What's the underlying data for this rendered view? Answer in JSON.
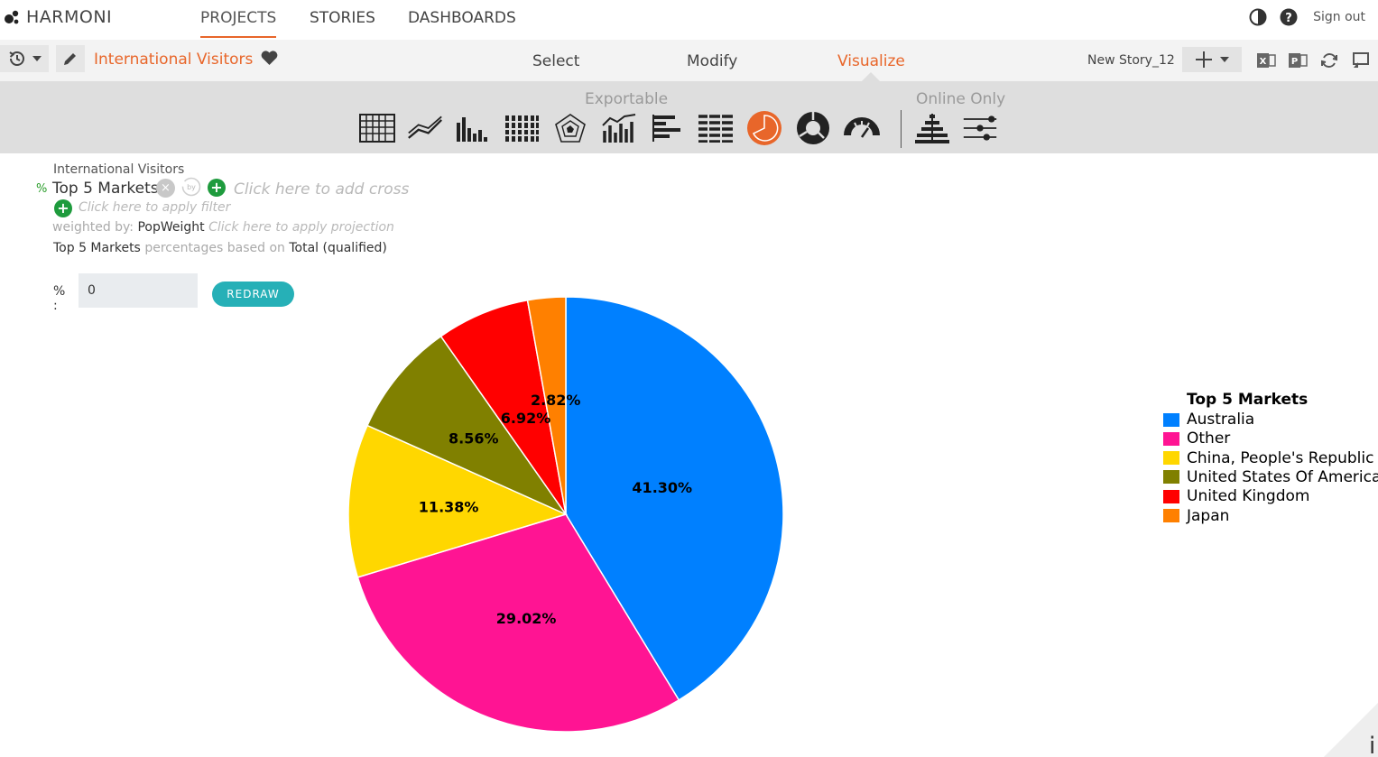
{
  "app": {
    "logo_text": "HARMONI"
  },
  "nav": {
    "tabs": [
      {
        "label": "PROJECTS",
        "active": true
      },
      {
        "label": "STORIES",
        "active": false
      },
      {
        "label": "DASHBOARDS",
        "active": false
      }
    ],
    "sign_out": "Sign out",
    "icons": [
      "contrast-icon",
      "help-icon"
    ]
  },
  "storybar": {
    "title": "International Visitors",
    "modes": [
      {
        "label": "Select",
        "active": false
      },
      {
        "label": "Modify",
        "active": false
      },
      {
        "label": "Visualize",
        "active": true
      }
    ],
    "story_name": "New Story_12"
  },
  "toolbar": {
    "exportable_label": "Exportable",
    "online_only_label": "Online Only",
    "chart_types": [
      "table-icon",
      "line-chart-icon",
      "bar-chart-icon",
      "stacked-column-icon",
      "radar-chart-icon",
      "combo-chart-icon",
      "horizontal-bar-icon",
      "stacked-bar-icon",
      "pie-chart-icon",
      "donut-chart-icon",
      "gauge-chart-icon",
      "pyramid-chart-icon",
      "slider-chart-icon"
    ],
    "selected": "pie-chart-icon"
  },
  "query": {
    "source": "International Visitors",
    "percent_symbol": "%",
    "rows": "Top 5 Markets",
    "by_label": "by",
    "cross_hint": "Click here to add cross",
    "filter_hint": "Click here to apply filter",
    "weighted_label": "weighted by:",
    "weight_var": "PopWeight",
    "projection_hint": "Click here to apply projection",
    "basis_var": "Top 5 Markets",
    "basis_mid": "percentages based on",
    "basis_total": "Total (qualified)",
    "pct_label": "% :",
    "pct_value": "0",
    "redraw_label": "REDRAW"
  },
  "chart_data": {
    "type": "pie",
    "legend_title": "Top 5 Markets",
    "legend_position": "right",
    "slices": [
      {
        "label": "Australia",
        "value": 41.3,
        "display": "41.30%",
        "color": "#0080ff"
      },
      {
        "label": "Other",
        "value": 29.02,
        "display": "29.02%",
        "color": "#ff1493"
      },
      {
        "label": "China, People's Republic Of",
        "value": 11.38,
        "display": "11.38%",
        "color": "#ffd700"
      },
      {
        "label": "United States Of America",
        "value": 8.56,
        "display": "8.56%",
        "color": "#808000"
      },
      {
        "label": "United Kingdom",
        "value": 6.92,
        "display": "6.92%",
        "color": "#ff0000"
      },
      {
        "label": "Japan",
        "value": 2.82,
        "display": "2.82%",
        "color": "#ff8000"
      }
    ]
  },
  "colors": {
    "accent": "#e8662a",
    "redraw": "#26b0b7",
    "add": "#1e9b3d"
  },
  "corner_label": "i"
}
